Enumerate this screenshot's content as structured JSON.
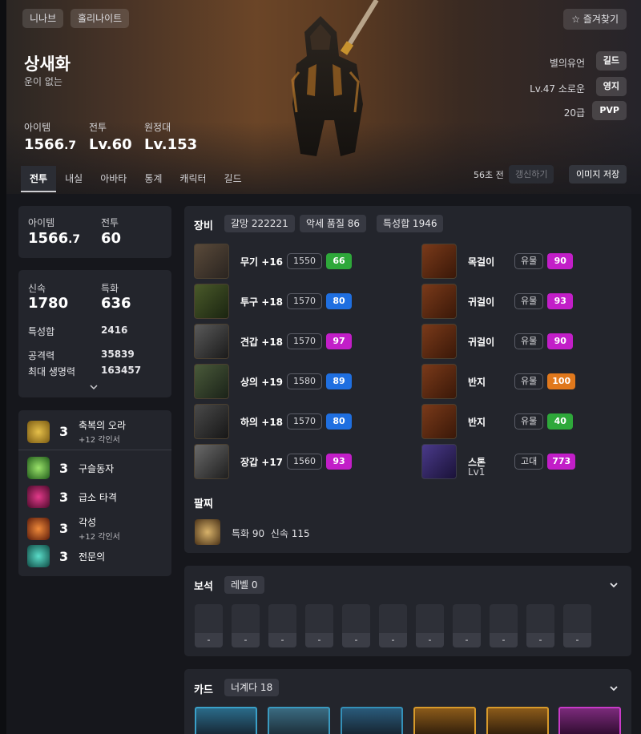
{
  "header": {
    "server_chip": "니나브",
    "class_chip": "홀리나이트",
    "favorite": "즐겨찾기",
    "character_name": "상새화",
    "title": "운이 없는",
    "stats": [
      {
        "label": "아이템",
        "value": "1566",
        "decimal": ".7"
      },
      {
        "label": "전투",
        "value": "Lv.60"
      },
      {
        "label": "원정대",
        "value": "Lv.153"
      }
    ],
    "right": [
      {
        "label": "별의유언",
        "button": "길드"
      },
      {
        "label": "Lv.47 소로운",
        "button": "영지"
      },
      {
        "label": "20급",
        "button": "PVP"
      }
    ]
  },
  "tabs": [
    "전투",
    "내실",
    "아바타",
    "통계",
    "캐릭터",
    "길드"
  ],
  "update": {
    "time": "56초 전",
    "refresh": "갱신하기",
    "save_image": "이미지 저장"
  },
  "summary": {
    "item": {
      "label": "아이템",
      "value": "1566",
      "decimal": ".7"
    },
    "combat": {
      "label": "전투",
      "value": "60"
    }
  },
  "stats": {
    "swiftness": {
      "label": "신속",
      "value": "1780"
    },
    "crit": {
      "label": "특화",
      "value": "636"
    },
    "total": {
      "label": "특성합",
      "value": "2416"
    },
    "attack": {
      "label": "공격력",
      "value": "35839"
    },
    "hp": {
      "label": "최대 생명력",
      "value": "163457"
    }
  },
  "engravings": [
    {
      "level": "3",
      "name": "축복의 오라",
      "sub": "+12 각인서",
      "color": "#c9a02a"
    },
    {
      "level": "3",
      "name": "구슬동자",
      "sub": "",
      "color": "#4fae3d"
    },
    {
      "level": "3",
      "name": "급소 타격",
      "sub": "",
      "color": "#b3246a"
    },
    {
      "level": "3",
      "name": "각성",
      "sub": "+12 각인서",
      "color": "#d4562a"
    },
    {
      "level": "3",
      "name": "전문의",
      "sub": "",
      "color": "#2a9c90"
    }
  ],
  "equipment": {
    "title": "장비",
    "tags": [
      "갈망 222221",
      "악세 품질 86",
      "특성합 1946"
    ],
    "left": [
      {
        "name": "무기 +16",
        "level": "1550",
        "quality": "66",
        "qcolor": "#2ea83a"
      },
      {
        "name": "투구 +18",
        "level": "1570",
        "quality": "80",
        "qcolor": "#1f6fe0"
      },
      {
        "name": "견갑 +18",
        "level": "1570",
        "quality": "97",
        "qcolor": "#c21ec8"
      },
      {
        "name": "상의 +19",
        "level": "1580",
        "quality": "89",
        "qcolor": "#1f6fe0"
      },
      {
        "name": "하의 +18",
        "level": "1570",
        "quality": "80",
        "qcolor": "#1f6fe0"
      },
      {
        "name": "장갑 +17",
        "level": "1560",
        "quality": "93",
        "qcolor": "#c21ec8"
      }
    ],
    "right": [
      {
        "name": "목걸이",
        "grade": "유물",
        "quality": "90",
        "qcolor": "#c21ec8"
      },
      {
        "name": "귀걸이",
        "grade": "유물",
        "quality": "93",
        "qcolor": "#c21ec8"
      },
      {
        "name": "귀걸이",
        "grade": "유물",
        "quality": "90",
        "qcolor": "#c21ec8"
      },
      {
        "name": "반지",
        "grade": "유물",
        "quality": "100",
        "qcolor": "#e0781c"
      },
      {
        "name": "반지",
        "grade": "유물",
        "quality": "40",
        "qcolor": "#2ea83a"
      },
      {
        "name": "스톤",
        "grade": "고대",
        "quality": "773",
        "qcolor": "#c21ec8",
        "sub": "Lv1"
      }
    ],
    "bracelet": {
      "title": "팔찌",
      "text": "특화 90  신속 115"
    }
  },
  "gems": {
    "title": "보석",
    "tag": "레벨 0",
    "slots": [
      "-",
      "-",
      "-",
      "-",
      "-",
      "-",
      "-",
      "-",
      "-",
      "-",
      "-"
    ]
  },
  "cards": {
    "title": "카드",
    "tag": "너계다 18"
  }
}
